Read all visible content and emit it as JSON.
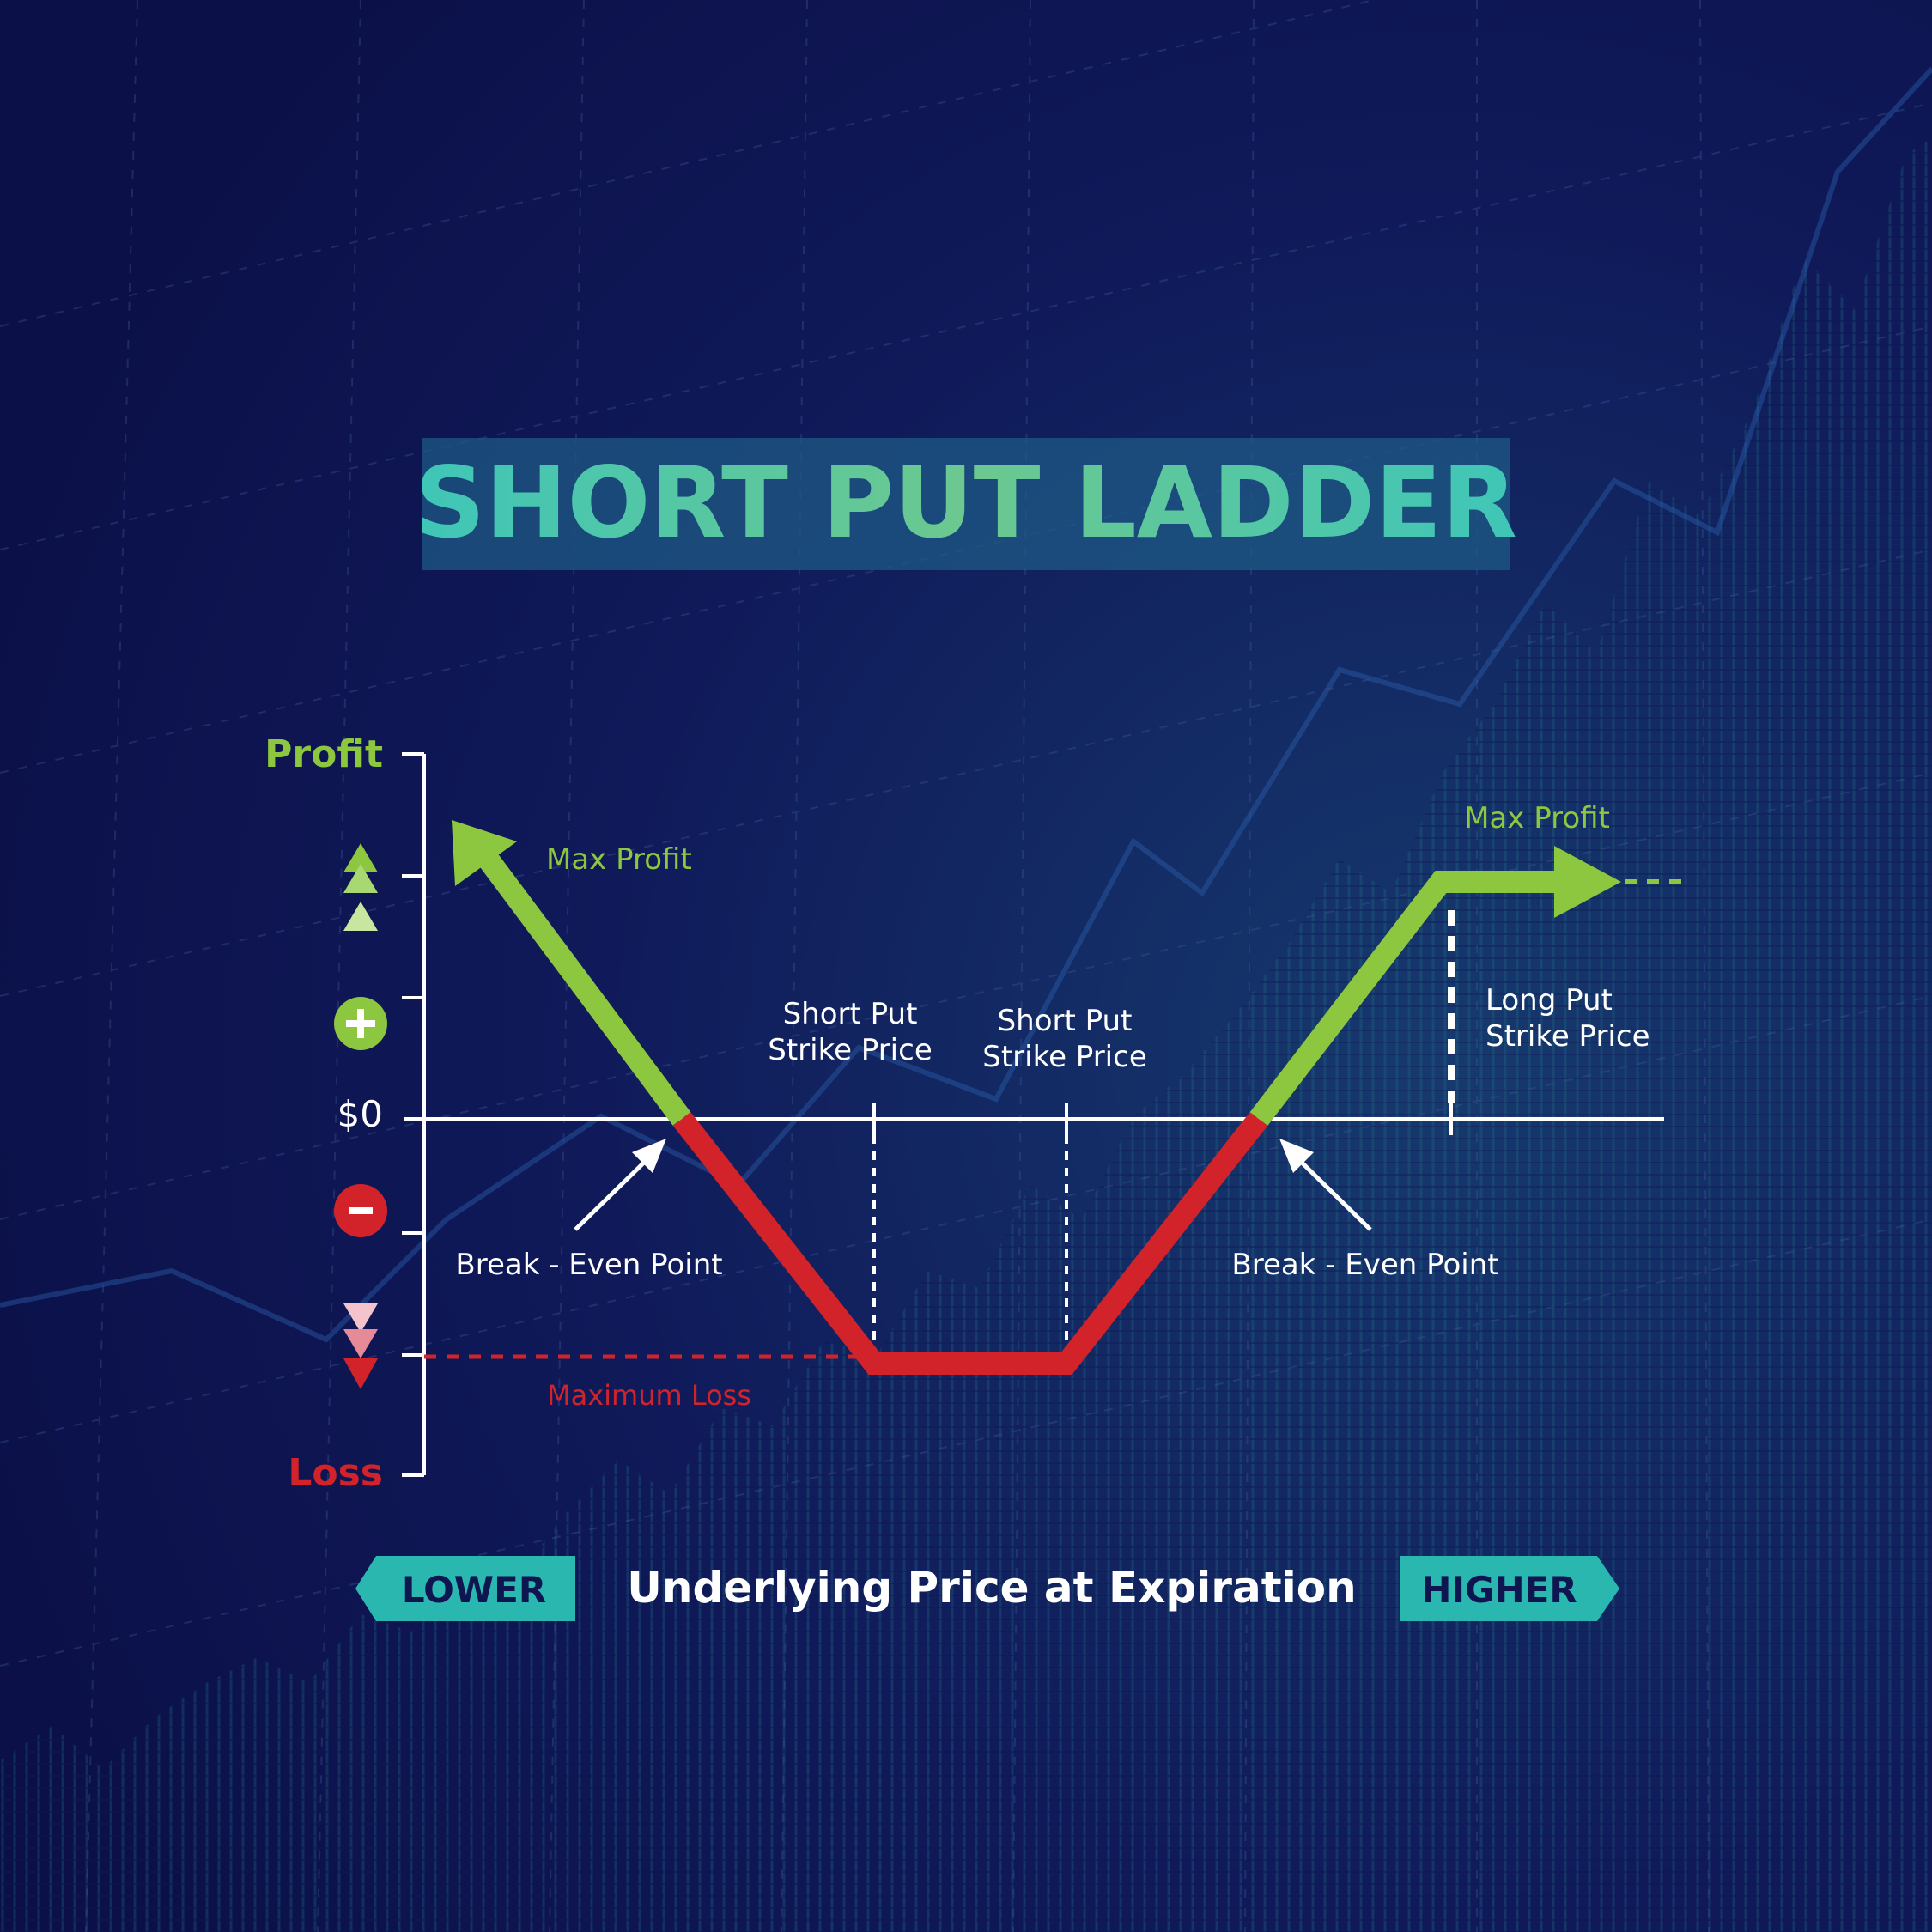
{
  "title": "SHORT PUT LADDER",
  "y_axis": {
    "top_label": "Profit",
    "bottom_label": "Loss",
    "zero_label": "$0"
  },
  "x_axis": {
    "label": "Underlying Price at Expiration",
    "left_tag": "LOWER",
    "right_tag": "HIGHER"
  },
  "annotations": {
    "max_profit_left": "Max Profit",
    "max_profit_right": "Max Profit",
    "short_put_strike_1": [
      "Short Put",
      "Strike Price"
    ],
    "short_put_strike_2": [
      "Short Put",
      "Strike Price"
    ],
    "long_put_strike": [
      "Long Put",
      "Strike Price"
    ],
    "break_even_left": "Break - Even Point",
    "break_even_right": "Break - Even Point",
    "maximum_loss": "Maximum Loss"
  },
  "colors": {
    "background": "#0e1550",
    "profit_green": "#8dc63f",
    "loss_red": "#d2232a",
    "teal": "#2ab7b0",
    "axis_white": "#ffffff",
    "title_band": "#1d5a86"
  },
  "icons": {
    "profit_indicator": "triple-up-arrow-icon",
    "plus": "plus-circle-icon",
    "minus": "minus-circle-icon",
    "loss_indicator": "triple-down-arrow-icon"
  }
}
